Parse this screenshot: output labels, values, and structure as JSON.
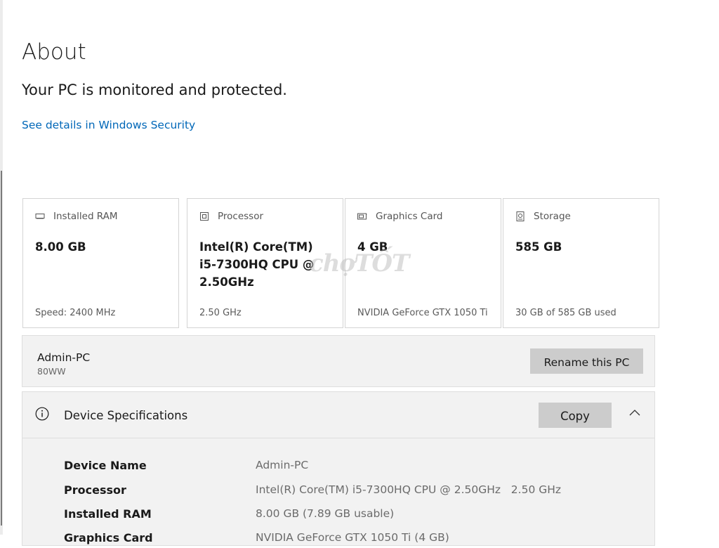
{
  "page": {
    "title": "About",
    "protection_status": "Your PC is monitored and protected.",
    "security_link": "See details in Windows Security"
  },
  "cards": [
    {
      "icon": "ram-icon",
      "label": "Installed RAM",
      "value": "8.00 GB",
      "sub": "Speed: 2400 MHz"
    },
    {
      "icon": "processor-icon",
      "label": "Processor",
      "value": "Intel(R) Core(TM) i5-7300HQ CPU @ 2.50GHz",
      "sub": "2.50 GHz"
    },
    {
      "icon": "graphics-card-icon",
      "label": "Graphics Card",
      "value": "4 GB",
      "sub": "NVIDIA GeForce GTX 1050 Ti"
    },
    {
      "icon": "storage-icon",
      "label": "Storage",
      "value": "585 GB",
      "sub": "30 GB of 585 GB used"
    }
  ],
  "watermark": "chợTỐT",
  "pc": {
    "name": "Admin-PC",
    "model": "80WW",
    "rename_label": "Rename this PC"
  },
  "specs": {
    "title": "Device Specifications",
    "copy_label": "Copy",
    "rows": [
      {
        "label": "Device Name",
        "value": "Admin-PC"
      },
      {
        "label": "Processor",
        "value": "Intel(R) Core(TM) i5-7300HQ CPU @ 2.50GHz   2.50 GHz"
      },
      {
        "label": "Installed RAM",
        "value": "8.00 GB (7.89 GB usable)"
      },
      {
        "label": "Graphics Card",
        "value": "NVIDIA GeForce GTX 1050 Ti (4 GB)"
      }
    ]
  },
  "colors": {
    "link": "#0067b8",
    "button": "#cccccc",
    "panel": "#f2f2f2"
  }
}
